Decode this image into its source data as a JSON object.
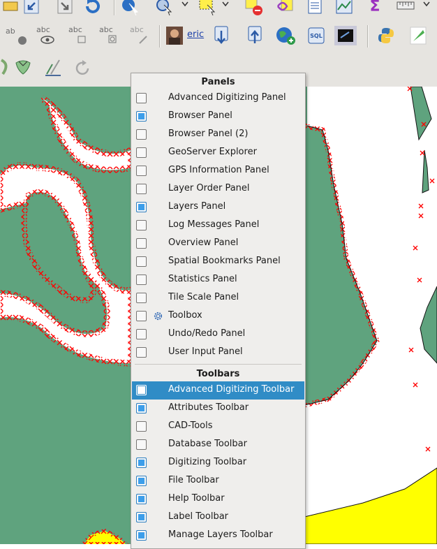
{
  "user": {
    "name": "eric"
  },
  "toolbar": {
    "abc_labels": [
      "abc",
      "abc",
      "abc",
      "abc",
      "abc"
    ],
    "sql_label": "SQL",
    "ab_label": "ab",
    "sigma": "Σ"
  },
  "panels_menu": {
    "panels_heading": "Panels",
    "panels": [
      {
        "label": "Advanced Digitizing Panel",
        "checked": false
      },
      {
        "label": "Browser Panel",
        "checked": true
      },
      {
        "label": "Browser Panel (2)",
        "checked": false
      },
      {
        "label": "GeoServer Explorer",
        "checked": false
      },
      {
        "label": "GPS Information Panel",
        "checked": false
      },
      {
        "label": "Layer Order Panel",
        "checked": false
      },
      {
        "label": "Layers Panel",
        "checked": true
      },
      {
        "label": "Log Messages Panel",
        "checked": false
      },
      {
        "label": "Overview Panel",
        "checked": false
      },
      {
        "label": "Spatial Bookmarks Panel",
        "checked": false
      },
      {
        "label": "Statistics Panel",
        "checked": false
      },
      {
        "label": "Tile Scale Panel",
        "checked": false
      },
      {
        "label": "Toolbox",
        "checked": false,
        "icon": "gear-icon"
      },
      {
        "label": "Undo/Redo Panel",
        "checked": false
      },
      {
        "label": "User Input Panel",
        "checked": false
      }
    ],
    "toolbars_heading": "Toolbars",
    "toolbars": [
      {
        "label": "Advanced Digitizing Toolbar",
        "checked": false,
        "highlighted": true
      },
      {
        "label": "Attributes Toolbar",
        "checked": true
      },
      {
        "label": "CAD-Tools",
        "checked": false
      },
      {
        "label": "Database Toolbar",
        "checked": false
      },
      {
        "label": "Digitizing Toolbar",
        "checked": true
      },
      {
        "label": "File Toolbar",
        "checked": true
      },
      {
        "label": "Help Toolbar",
        "checked": true
      },
      {
        "label": "Label Toolbar",
        "checked": true
      },
      {
        "label": "Manage Layers Toolbar",
        "checked": true
      }
    ]
  },
  "colors": {
    "polygon_fill": "#5fa37e",
    "vertex_marker": "#ff0000",
    "yellow_layer": "#ffff00",
    "menu_highlight": "#308cc6",
    "checkbox_checked": "#3d9eea"
  }
}
